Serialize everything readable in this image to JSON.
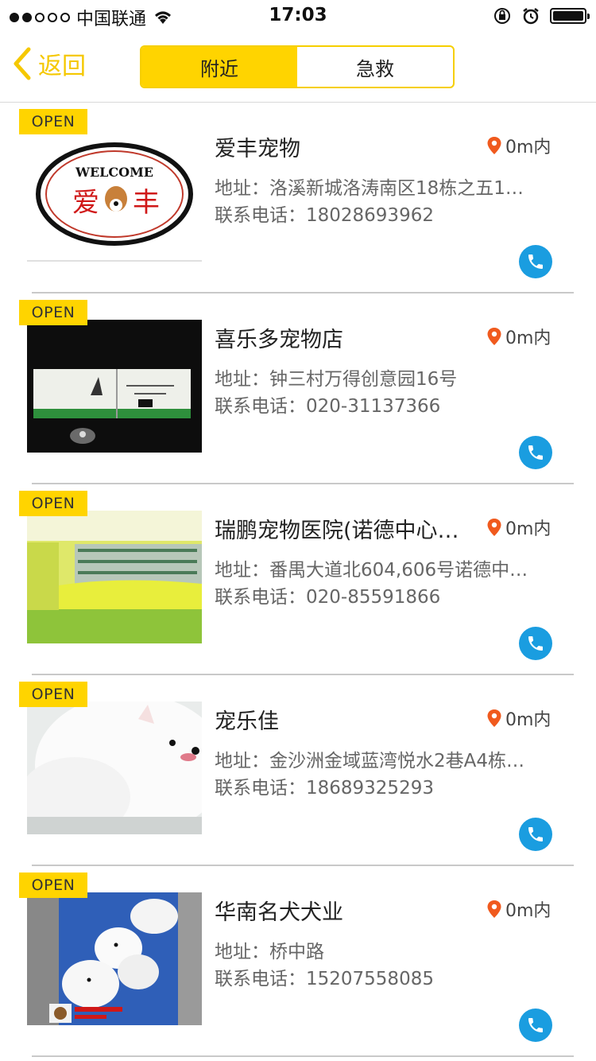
{
  "status_bar": {
    "carrier": "中国联通",
    "time": "17:03",
    "signal_dots_filled": 2,
    "signal_dots_total": 5
  },
  "nav": {
    "back_label": "返回",
    "tabs": [
      {
        "label": "附近",
        "active": true
      },
      {
        "label": "急救",
        "active": false
      }
    ]
  },
  "shops": [
    {
      "badge": "OPEN",
      "name": "爱丰宠物",
      "distance": "0m内",
      "address": "地址：洛溪新城洛涛南区18栋之五1…",
      "phone": "联系电话：18028693962"
    },
    {
      "badge": "OPEN",
      "name": "喜乐多宠物店",
      "distance": "0m内",
      "address": "地址：钟三村万得创意园16号",
      "phone": "联系电话：020-31137366"
    },
    {
      "badge": "OPEN",
      "name": "瑞鹏宠物医院(诺德中心…",
      "distance": "0m内",
      "address": "地址：番禺大道北604,606号诺德中…",
      "phone": "联系电话：020-85591866"
    },
    {
      "badge": "OPEN",
      "name": "宠乐佳",
      "distance": "0m内",
      "address": "地址：金沙洲金域蓝湾悦水2巷A4栋…",
      "phone": "联系电话：18689325293"
    },
    {
      "badge": "OPEN",
      "name": "华南名犬犬业",
      "distance": "0m内",
      "address": "地址：桥中路",
      "phone": "联系电话：15207558085"
    }
  ],
  "thumb_logo": {
    "welcome": "WELCOME",
    "char_left": "爱",
    "char_right": "丰"
  },
  "colors": {
    "accent": "#ffd400",
    "call": "#1a9de0",
    "pin": "#f05a1e"
  }
}
